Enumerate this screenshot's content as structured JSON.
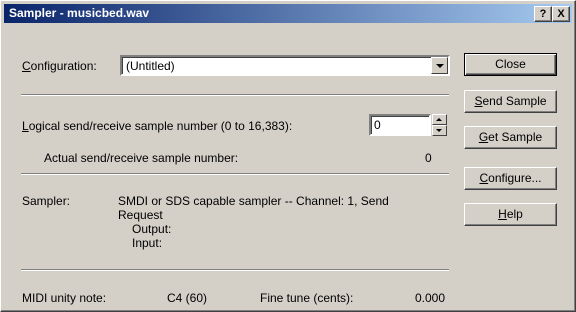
{
  "window": {
    "title": "Sampler - musicbed.wav",
    "help_btn": "?",
    "close_btn": "X"
  },
  "config": {
    "label_first": "C",
    "label_rest": "onfiguration:",
    "value": "(Untitled)"
  },
  "sample": {
    "logical_label_first": "L",
    "logical_label_rest": "ogical send/receive sample number (0 to 16,383):",
    "logical_value": "0",
    "actual_label": "Actual send/receive sample number:",
    "actual_value": "0"
  },
  "sampler": {
    "label": "Sampler:",
    "line1": "SMDI or SDS capable sampler -- Channel: 1, Send",
    "line2": "Request",
    "output_label": "Output:",
    "input_label": "Input:"
  },
  "midi": {
    "unity_label": "MIDI unity note:",
    "unity_value": "C4 (60)",
    "fine_label": "Fine tune (cents):",
    "fine_value": "0.000"
  },
  "buttons": {
    "close": "Close",
    "send_first": "S",
    "send_rest": "end Sample",
    "get_first": "G",
    "get_rest": "et Sample",
    "configure_first": "Configure...",
    "configure_u": "C",
    "configure_rest": "onfigure...",
    "help_first": "H",
    "help_rest": "elp"
  }
}
